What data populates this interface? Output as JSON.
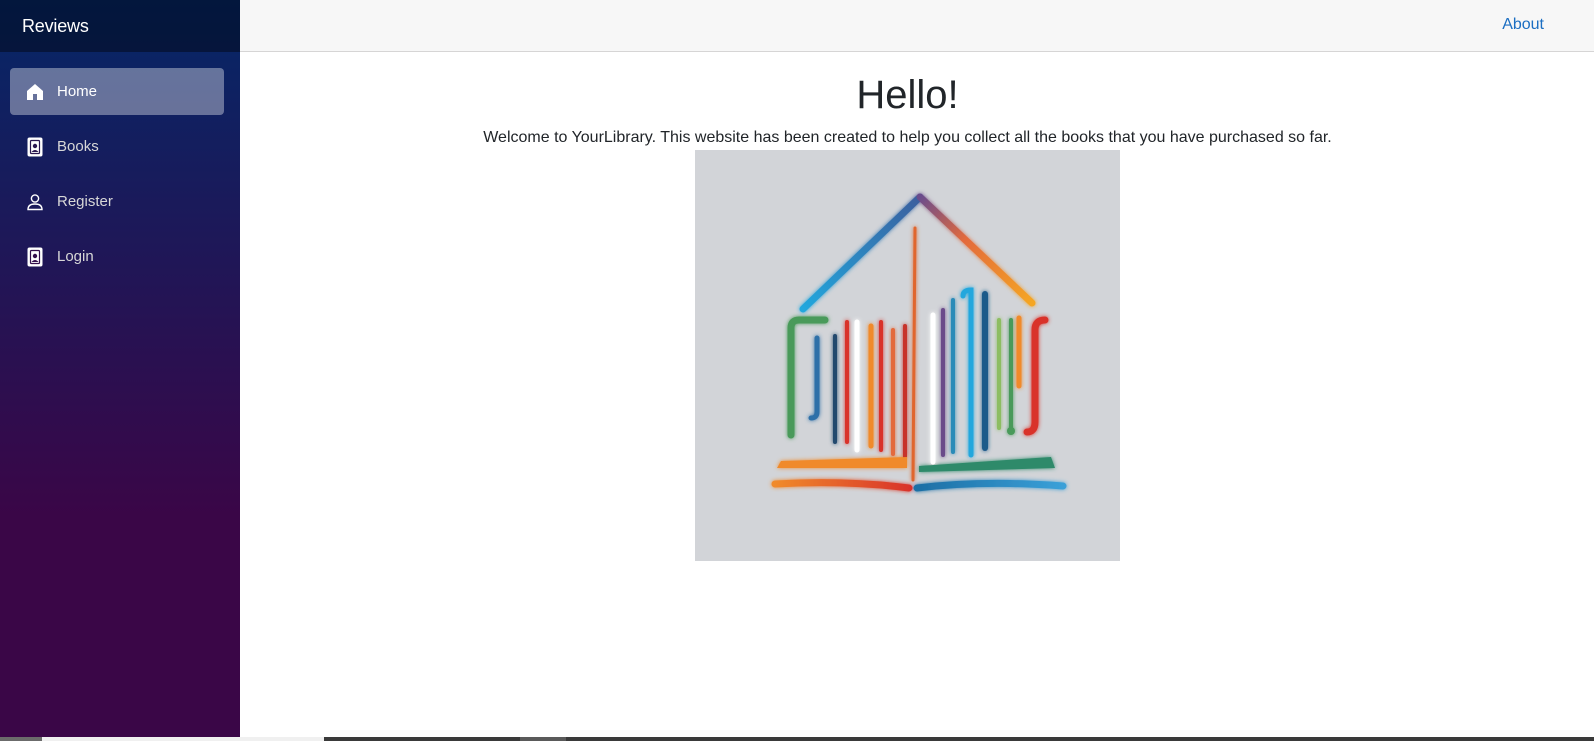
{
  "app": {
    "brand": "Reviews"
  },
  "sidebar": {
    "items": [
      {
        "label": "Home",
        "icon": "home-icon",
        "active": true
      },
      {
        "label": "Books",
        "icon": "contact-card-icon",
        "active": false
      },
      {
        "label": "Register",
        "icon": "person-icon",
        "active": false
      },
      {
        "label": "Login",
        "icon": "contact-card-icon",
        "active": false
      }
    ]
  },
  "topbar": {
    "about_label": "About"
  },
  "main": {
    "title": "Hello!",
    "welcome": "Welcome to YourLibrary. This website has been created to help you collect all the books that you have purchased so far.",
    "logo": "library-logo-image"
  },
  "colors": {
    "sidebar_top": "#052767",
    "sidebar_bottom": "#3a0647",
    "link": "#1b6ec2",
    "topbar": "#f7f7f7"
  }
}
